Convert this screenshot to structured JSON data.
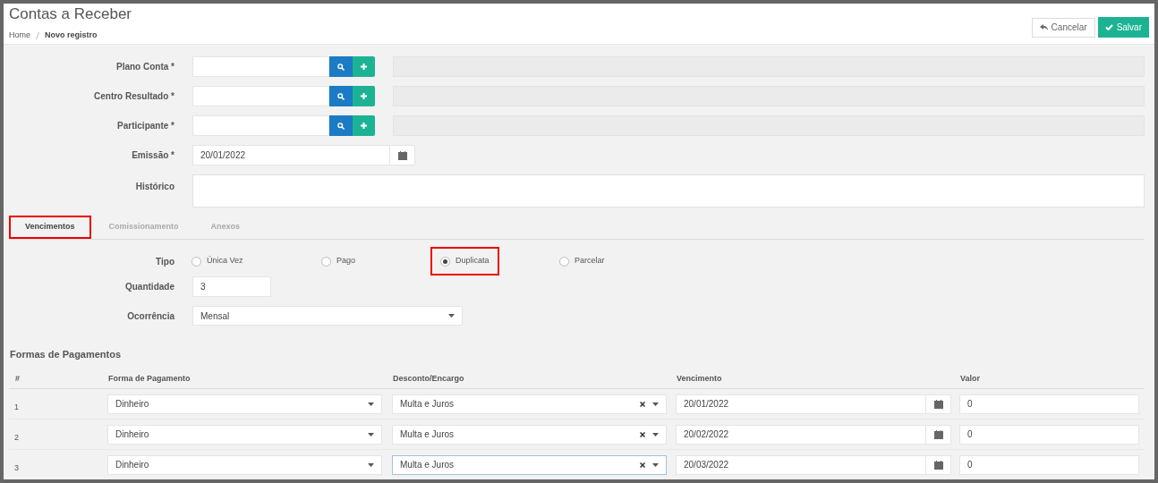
{
  "page": {
    "title": "Contas a Receber",
    "breadcrumb": [
      {
        "label": "Home",
        "current": false
      },
      {
        "label": "Novo registro",
        "current": true
      }
    ]
  },
  "actions": [
    {
      "kind": "cancel",
      "label": "Cancelar"
    },
    {
      "kind": "save",
      "label": "Salvar"
    }
  ],
  "fields": [
    {
      "kind": "lookup",
      "label": "Plano Conta *"
    },
    {
      "kind": "lookup",
      "label": "Centro Resultado *"
    },
    {
      "kind": "lookup",
      "label": "Participante *"
    },
    {
      "kind": "date",
      "label": "Emissão *",
      "value": "20/01/2022"
    },
    {
      "kind": "textarea",
      "label": "Histórico"
    }
  ],
  "tabs": [
    {
      "label": "Vencimentos",
      "selected": true,
      "highlighted": true
    },
    {
      "label": "Comissionamento",
      "selected": false,
      "highlighted": false
    },
    {
      "label": "Anexos",
      "selected": false,
      "highlighted": false
    }
  ],
  "tipo": {
    "label": "Tipo",
    "options": [
      {
        "label": "Única Vez",
        "selected": false,
        "highlighted": false
      },
      {
        "label": "Pago",
        "selected": false,
        "highlighted": false
      },
      {
        "label": "Duplicata",
        "selected": true,
        "highlighted": true
      },
      {
        "label": "Parcelar",
        "selected": false,
        "highlighted": false
      }
    ]
  },
  "quantidade": {
    "label": "Quantidade",
    "value": "3"
  },
  "ocorrencia": {
    "label": "Ocorrência",
    "value": "Mensal"
  },
  "payments": {
    "title": "Formas de Pagamentos",
    "columns": [
      "#",
      "Forma de Pagamento",
      "Desconto/Encargo",
      "Vencimento",
      "Valor"
    ],
    "rows": [
      {
        "index": "1",
        "forma": "Dinheiro",
        "desconto": "Multa e Juros",
        "vencimento": "20/01/2022",
        "valor": "0",
        "focused": false
      },
      {
        "index": "2",
        "forma": "Dinheiro",
        "desconto": "Multa e Juros",
        "vencimento": "20/02/2022",
        "valor": "0",
        "focused": false
      },
      {
        "index": "3",
        "forma": "Dinheiro",
        "desconto": "Multa e Juros",
        "vencimento": "20/03/2022",
        "valor": "0",
        "focused": true
      }
    ]
  }
}
